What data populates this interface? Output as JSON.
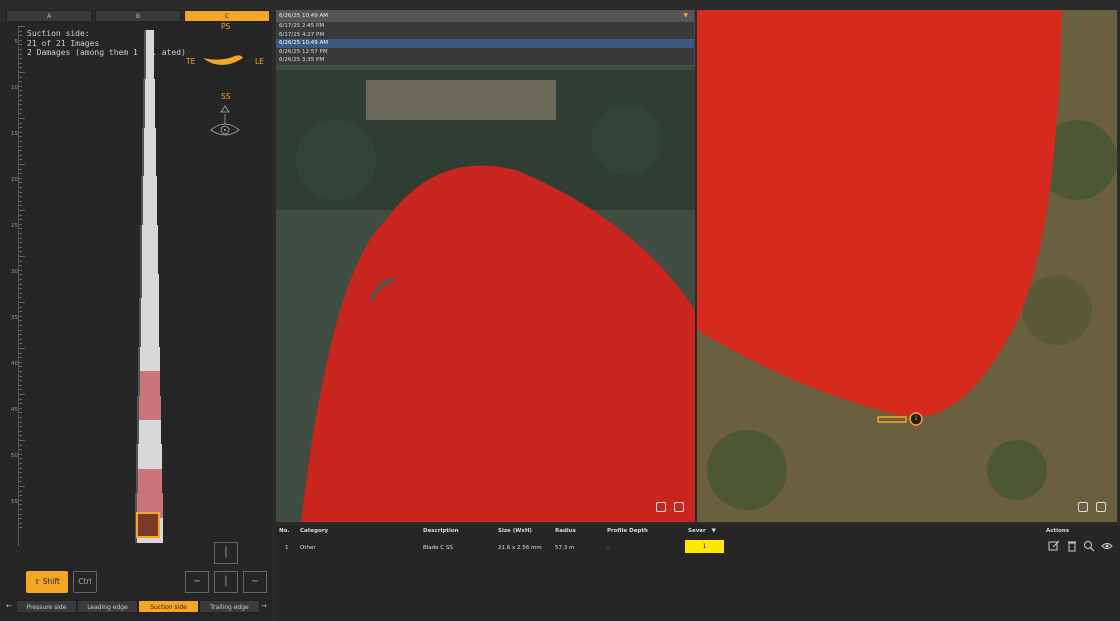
{
  "blade_tabs": [
    "A",
    "B",
    "C"
  ],
  "info": {
    "line1": "Suction side:",
    "line2": "21 of 21 Images",
    "line3": "2 Damages (among them 1 ... ated)"
  },
  "ruler_ticks": [
    "5",
    "10",
    "15",
    "20",
    "25",
    "30",
    "35",
    "40",
    "45",
    "50",
    "55"
  ],
  "orientation": {
    "ps": "PS",
    "te": "TE",
    "le": "LE",
    "ss": "SS"
  },
  "keys": {
    "shift": "Shift",
    "ctrl": "Ctrl"
  },
  "side_tabs": [
    "Pressure side",
    "Leading edge",
    "Suction side",
    "Trailing edge"
  ],
  "dates": {
    "selected": "6/26/25 10:49 AM",
    "options": [
      "6/17/25 2:45 PM",
      "6/17/25 4:27 PM",
      "6/26/25 10:49 AM",
      "6/26/25 12:57 PM",
      "6/26/25 3:35 PM"
    ]
  },
  "table": {
    "headers": [
      "No.",
      "Category",
      "Description",
      "Size (WxH)",
      "Radius",
      "Profile Depth",
      "Sever",
      "Actions"
    ],
    "rows": [
      {
        "no": "1",
        "category": "Other",
        "description": "Blade C SS",
        "size": "21.6 x 2.56 mm",
        "radius": "57.3 m",
        "profile_depth": "-",
        "severity": "1"
      }
    ]
  },
  "annotation_marker": "1",
  "colors": {
    "accent": "#f5a623",
    "severity": "#ffe800",
    "blade": "#cc2a20"
  }
}
